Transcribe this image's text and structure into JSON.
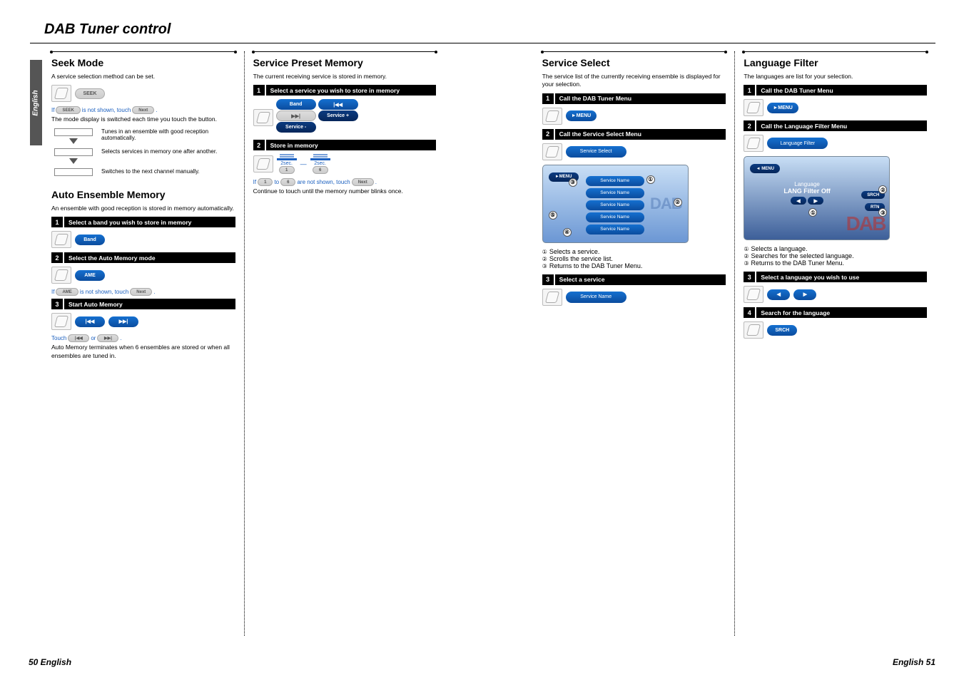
{
  "title": "DAB Tuner control",
  "side_tab": "English",
  "footer_left": "50 English",
  "footer_right": "English 51",
  "col1": {
    "seek": {
      "heading": "Seek Mode",
      "intro": "A service selection method can be set.",
      "pill": "SEEK",
      "note_if": "If",
      "note_seek_btn": "SEEK",
      "note_mid": " is not shown, touch ",
      "note_next_btn": "Next",
      "note_end": ".",
      "note_line2": "The mode display is switched each time you touch the button.",
      "mode1": "Tunes in an ensemble with good reception automatically.",
      "mode2": "Selects services in memory one after another.",
      "mode3": "Switches to the next channel manually."
    },
    "auto": {
      "heading": "Auto Ensemble Memory",
      "intro": "An ensemble with good reception is stored in memory automatically.",
      "step1": "Select a band you wish to store in memory",
      "band_btn": "Band",
      "step2": "Select the Auto Memory mode",
      "ame_btn": "AME",
      "ame_note_if": "If",
      "ame_note_btn": "AME",
      "ame_note_mid": " is not shown, touch ",
      "ame_note_next": "Next",
      "ame_note_end": ".",
      "step3": "Start Auto Memory",
      "touch_pre": "Touch ",
      "touch_mid": " or ",
      "touch_end": ".",
      "outro": "Auto Memory terminates when 6 ensembles are stored or when all ensembles are tuned in."
    }
  },
  "col2": {
    "heading": "Service Preset Memory",
    "intro": "The current receiving service is stored in memory.",
    "step1": "Select a service you wish to store in memory",
    "band_btn": "Band",
    "prev_btn": "|◀◀",
    "next_btn": "▶▶|",
    "svc_plus": "Service +",
    "svc_minus": "Service -",
    "step2": "Store in memory",
    "sec_label": "2sec.",
    "mem_from": "1",
    "mem_dash": "—",
    "mem_to": "6",
    "note_if": "If ",
    "note_one": "1",
    "note_to": " to ",
    "note_six": "6",
    "note_mid": " are not shown, touch ",
    "note_next": "Next",
    "note_end": ".",
    "outro": "Continue to touch until the memory number blinks once."
  },
  "col3": {
    "heading": "Service Select",
    "intro": "The service list of the currently receiving ensemble is displayed for your selection.",
    "step1": "Call the DAB Tuner Menu",
    "menu_btn": "►MENU",
    "step2": "Call the Service Select Menu",
    "svcsel_btn": "Service Select",
    "svc_name": "Service Name",
    "dab": "DAB",
    "leg1": "Selects a service.",
    "leg2": "Scrolls the service list.",
    "leg3": "Returns to the DAB Tuner Menu.",
    "step3": "Select a service",
    "svcname_btn": "Service Name"
  },
  "col4": {
    "heading": "Language Filter",
    "intro": "The languages are list for your selection.",
    "step1": "Call the DAB Tuner Menu",
    "menu_btn": "►MENU",
    "step2": "Call the Language Filter Menu",
    "langfilter_btn": "Language Filter",
    "ss_line1": "Language",
    "ss_line2": "LANG Filter Off",
    "ss_menu": "◄ MENU",
    "ss_srch": "SRCH",
    "ss_rtn": "RTN",
    "dab": "DAB",
    "leg1": "Selects a language.",
    "leg2": "Searches for the selected language.",
    "leg3": "Returns to the DAB Tuner Menu.",
    "step3": "Select a language you wish to use",
    "left_btn": "◀",
    "right_btn": "▶",
    "step4": "Search for the language",
    "srch_btn": "SRCH"
  },
  "circled": {
    "c1": "①",
    "c2": "②",
    "c3": "③",
    "c4": "④",
    "c5": "⑤"
  }
}
